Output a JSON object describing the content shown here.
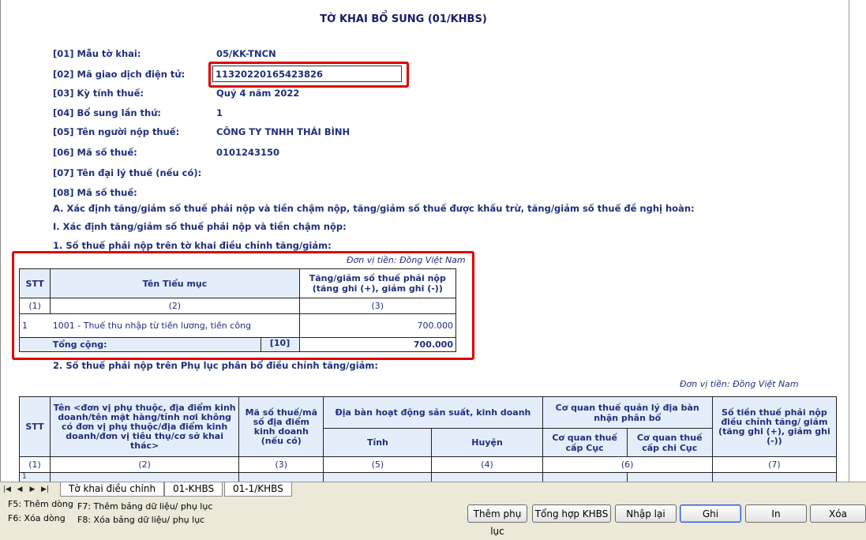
{
  "form": {
    "title": "TỜ KHAI BỔ SUNG (01/KHBS)",
    "fields": [
      {
        "label": "[01] Mẫu tờ khai:",
        "value": "05/KK-TNCN"
      },
      {
        "label": "[02] Mã giao dịch điện tử:",
        "value": "11320220165423826"
      },
      {
        "label": "[03] Kỳ tính thuế:",
        "value": "Quý 4 năm 2022"
      },
      {
        "label": "[04] Bổ sung lần thứ:",
        "value": "1"
      },
      {
        "label": "[05] Tên người nộp thuế:",
        "value": "CÔNG TY TNHH THÁI BÌNH"
      },
      {
        "label": "[06] Mã số thuế:",
        "value": "0101243150"
      },
      {
        "label": "[07] Tên đại lý thuế (nếu có):",
        "value": ""
      },
      {
        "label": "[08] Mã số thuế:",
        "value": ""
      }
    ],
    "section_a": "A. Xác định tăng/giảm số thuế phải nộp và tiền chậm nộp, tăng/giảm số thuế được khấu trừ, tăng/giảm số thuế đề nghị hoàn:",
    "section_i": "I. Xác định tăng/giảm số thuế phải nộp và tiền chậm nộp:",
    "section_1": "1. Số thuế phải nộp trên tờ khai điều chỉnh tăng/giảm:",
    "unit": "Đơn vị tiền: Đồng Việt Nam",
    "table1": {
      "headers": [
        "STT",
        "Tên Tiểu mục",
        "Tăng/giảm số thuế phải nộp (tăng ghi (+), giảm ghi (-))"
      ],
      "index_row": [
        "(1)",
        "(2)",
        "(3)"
      ],
      "row": {
        "stt": "1",
        "name": "1001 - Thuế thu nhập từ tiền lương, tiền công",
        "amount": "700.000"
      },
      "total": {
        "label": "Tổng cộng:",
        "code": "[10]",
        "amount": "700.000"
      }
    },
    "section_2": "2. Số thuế phải nộp trên Phụ lục phân bổ điều chỉnh tăng/giảm:",
    "unit2": "Đơn vị tiền: Đồng Việt Nam",
    "table2": {
      "h_stt": "STT",
      "h_name": "Tên <đơn vị phụ thuộc, địa điểm kinh doanh/tên mặt hàng/tỉnh nơi không có đơn vị phụ thuộc/địa điểm kinh doanh/đơn vị tiêu thụ/cơ sở khai thác>",
      "h_mst": "Mã số thuế/mã số địa điểm kinh doanh (nếu có)",
      "h_area": "Địa bàn hoạt động sản suất, kinh doanh",
      "h_tinh": "Tỉnh",
      "h_huyen": "Huyện",
      "h_cqt": "Cơ quan thuế quản lý địa bàn nhận phân bổ",
      "h_cuc": "Cơ quan thuế cấp Cục",
      "h_chicuc": "Cơ quan thuế cấp chi Cục",
      "h_amount": "Số tiền thuế phải nộp điều chỉnh tăng/ giảm (tăng ghi (+), giảm ghi (-))",
      "index_row": [
        "(1)",
        "(2)",
        "(3)",
        "(5)",
        "(4)",
        "(6)",
        "(7)"
      ],
      "first_row_stt": "1"
    }
  },
  "tabs": [
    "Tờ khai điều chỉnh",
    "01-KHBS",
    "01-1/KHBS"
  ],
  "active_tab": "01-KHBS",
  "hints": {
    "f5": "F5: Thêm dòng",
    "f6": "F6: Xóa dòng",
    "f7": "F7: Thêm bảng dữ liệu/ phụ lục",
    "f8": "F8: Xóa bảng dữ liệu/ phụ lục"
  },
  "buttons": {
    "add_appendix": "Thêm phụ lục",
    "summary": "Tổng hợp KHBS",
    "reset": "Nhập lại",
    "save": "Ghi",
    "print": "In",
    "delete": "Xóa"
  }
}
